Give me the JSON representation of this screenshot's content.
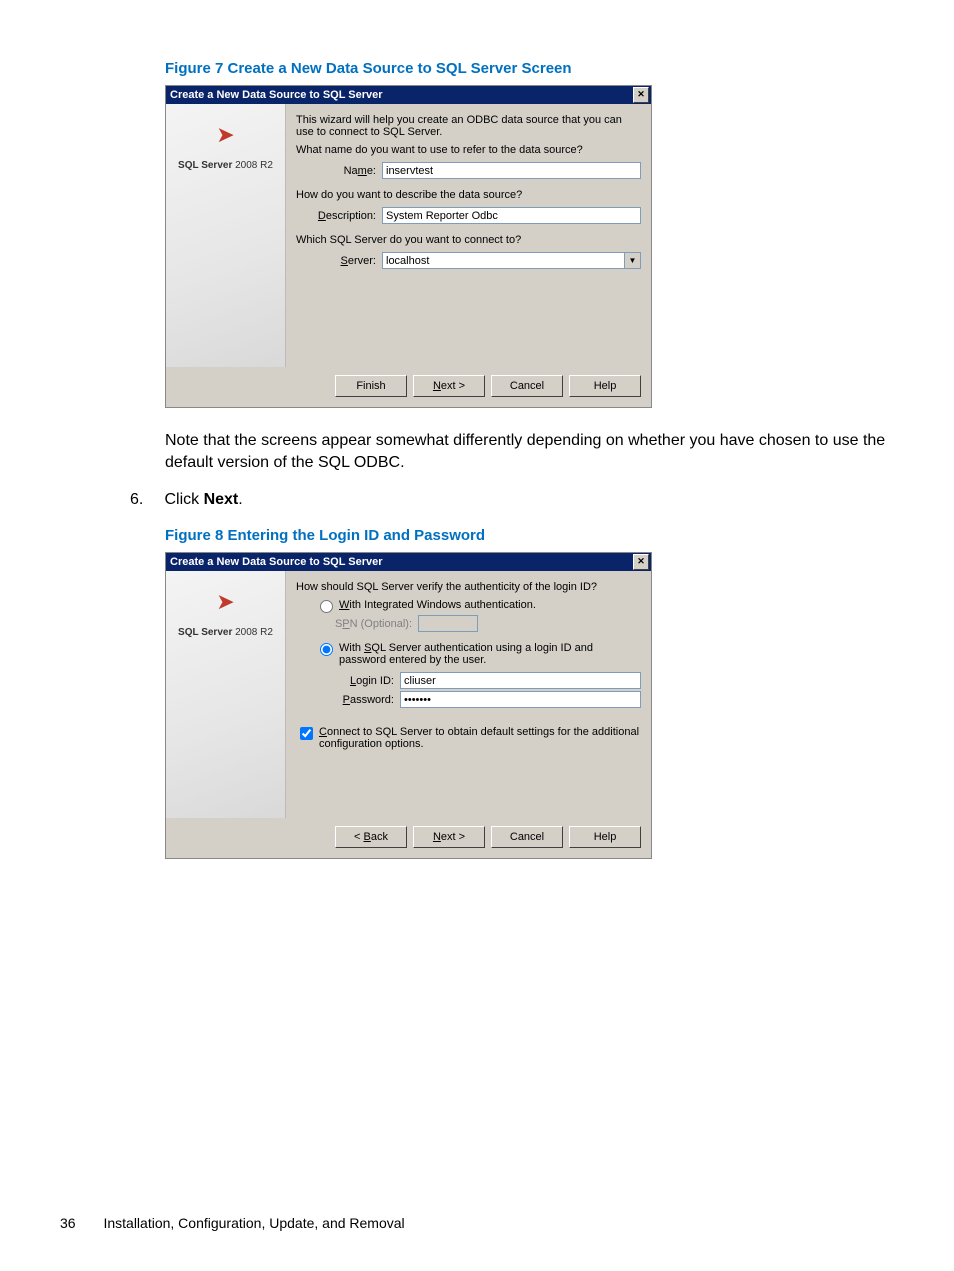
{
  "figure7": {
    "caption": "Figure 7 Create a New Data Source to SQL Server Screen",
    "title": "Create a New Data Source to SQL Server",
    "sidebrand": "SQL Server 2008 R2",
    "intro1": "This wizard will help you create an ODBC data source that you can use to connect to SQL Server.",
    "intro2": "What name do you want to use to refer to the data source?",
    "name_label": "Name:",
    "name_value": "inservtest",
    "desc_q": "How do you want to describe the data source?",
    "desc_label": "Description:",
    "desc_value": "System Reporter Odbc",
    "server_q": "Which SQL Server do you want to connect to?",
    "server_label": "Server:",
    "server_value": "localhost",
    "btn_finish": "Finish",
    "btn_next": "Next >",
    "btn_cancel": "Cancel",
    "btn_help": "Help"
  },
  "note_text": "Note that the screens appear somewhat differently depending on whether you have chosen to use the default version of the SQL ODBC.",
  "step6": {
    "num": "6.",
    "text_before": "Click ",
    "bold": "Next",
    "text_after": "."
  },
  "figure8": {
    "caption": "Figure 8 Entering the Login ID and Password",
    "title": "Create a New Data Source to SQL Server",
    "sidebrand": "SQL Server 2008 R2",
    "q1": "How should SQL Server verify the authenticity of the login ID?",
    "radio1": "With Integrated Windows authentication.",
    "spn_label": "SPN (Optional):",
    "radio2": "With SQL Server authentication using a login ID and password entered by the user.",
    "login_label": "Login ID:",
    "login_value": "cliuser",
    "pwd_label": "Password:",
    "pwd_value": "•••••••",
    "chk1": "Connect to SQL Server to obtain default settings for the additional configuration options.",
    "btn_back": "< Back",
    "btn_next": "Next >",
    "btn_cancel": "Cancel",
    "btn_help": "Help"
  },
  "footer": {
    "page_num": "36",
    "section": "Installation, Configuration, Update, and Removal"
  }
}
